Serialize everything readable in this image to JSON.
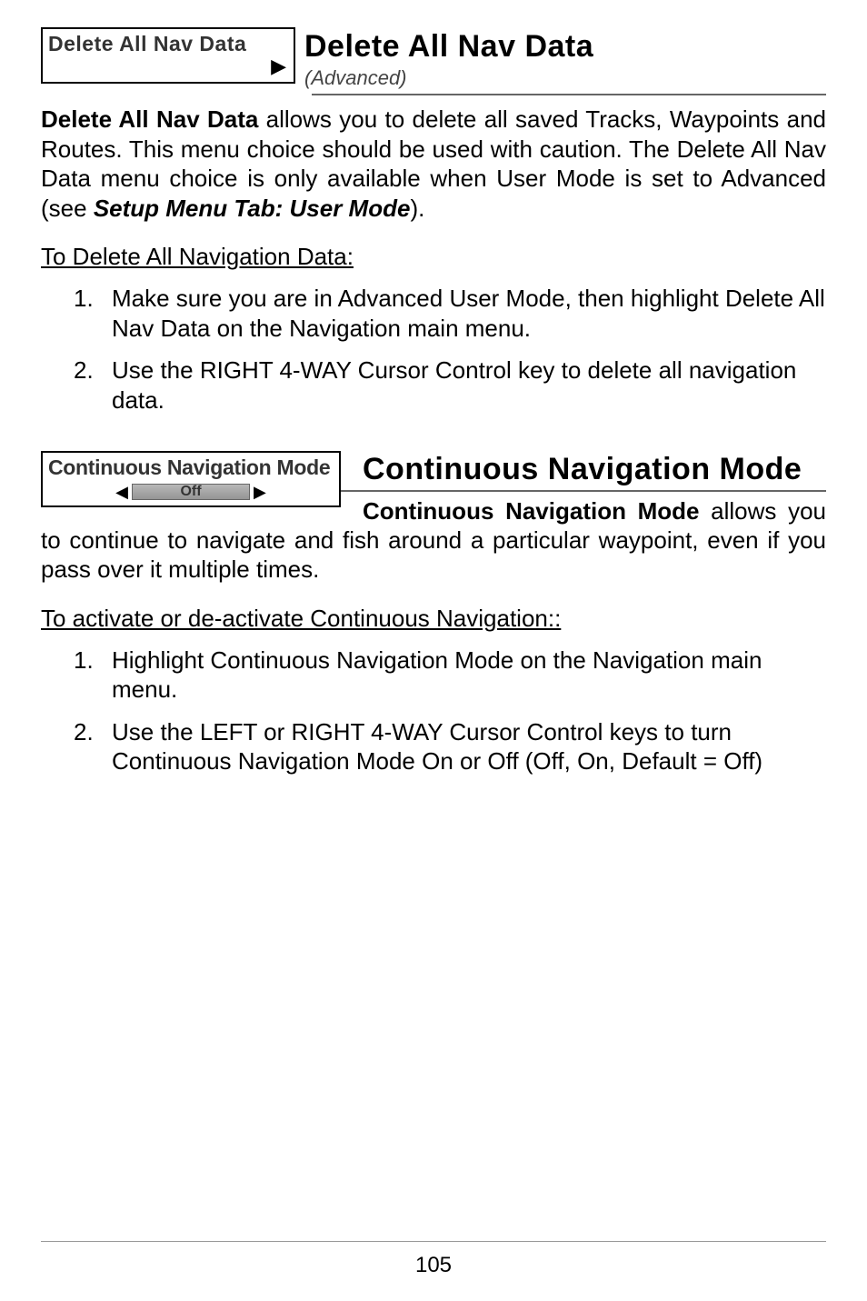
{
  "section1": {
    "menu_box_label": "Delete All Nav Data",
    "title": "Delete All Nav Data",
    "subtitle": "(Advanced)",
    "body_prefix_bold": "Delete All Nav Data",
    "body_rest_1": " allows you to delete all saved Tracks, Waypoints and Routes. This menu choice should be used with caution. The Delete All Nav Data menu choice is only available when User Mode is set to Advanced (see ",
    "body_italic": "Setup Menu Tab: User Mode",
    "body_rest_2": ").",
    "subheading": "To Delete All Navigation Data:",
    "list": [
      "Make sure you are in Advanced User Mode, then highlight Delete All Nav Data on the Navigation main menu.",
      "Use the RIGHT 4-WAY Cursor Control key to delete all navigation data."
    ]
  },
  "section2": {
    "menu_box_label": "Continuous Navigation Mode",
    "off_label": "Off",
    "title": "Continuous Navigation Mode",
    "body_prefix_bold": "Continuous Navigation Mode",
    "body_rest": " allows you to continue to navigate and fish around a particular waypoint, even if you pass over it multiple times.",
    "subheading": "To activate or de-activate Continuous Navigation::",
    "list": [
      "Highlight Continuous Navigation Mode on the Navigation main menu.",
      "Use the LEFT or RIGHT 4-WAY Cursor Control keys to turn Continuous Navigation Mode On or Off (Off, On, Default = Off)"
    ]
  },
  "page_number": "105",
  "icons": {
    "arrow_right": "▶",
    "tri_left": "◀",
    "tri_right": "▶"
  }
}
